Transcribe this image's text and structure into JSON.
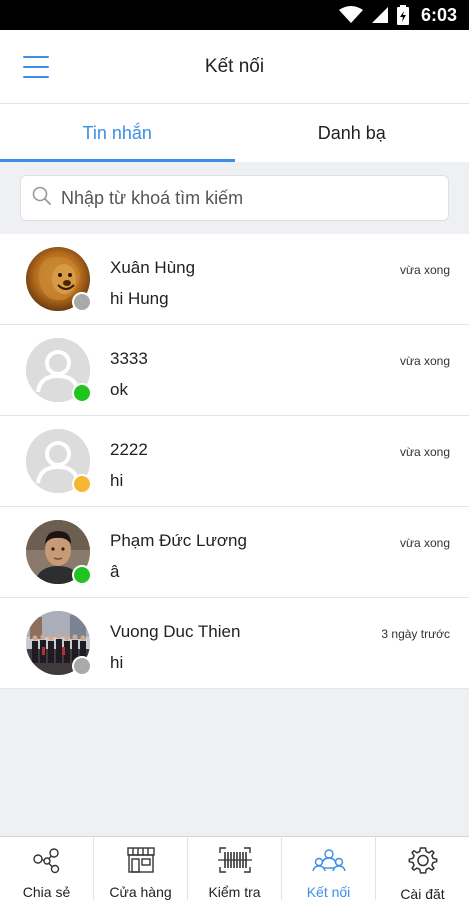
{
  "status_bar": {
    "time": "6:03"
  },
  "header": {
    "title": "Kết nối"
  },
  "tabs": [
    {
      "label": "Tin nhắn",
      "active": true
    },
    {
      "label": "Danh bạ",
      "active": false
    }
  ],
  "search": {
    "placeholder": "Nhập từ khoá tìm kiếm"
  },
  "conversations": [
    {
      "name": "Xuân Hùng",
      "message": "hi Hung",
      "time": "vừa xong",
      "status_color": "#a9a9a9"
    },
    {
      "name": "3333",
      "message": "ok",
      "time": "vừa xong",
      "status_color": "#1fc41f"
    },
    {
      "name": "2222",
      "message": "hi",
      "time": "vừa xong",
      "status_color": "#f5b731"
    },
    {
      "name": "Phạm Đức Lương",
      "message": "â",
      "time": "vừa xong",
      "status_color": "#1fc41f"
    },
    {
      "name": "Vuong Duc Thien",
      "message": "hi",
      "time": "3 ngày trước",
      "status_color": "#a9a9a9"
    }
  ],
  "bottom_nav": [
    {
      "label": "Chia sẻ",
      "icon": "share-icon"
    },
    {
      "label": "Cửa hàng",
      "icon": "store-icon"
    },
    {
      "label": "Kiểm tra",
      "icon": "barcode-icon"
    },
    {
      "label": "Kết nối",
      "icon": "connect-icon",
      "active": true
    },
    {
      "label": "Cài đặt",
      "icon": "gear-icon"
    }
  ],
  "colors": {
    "accent": "#3c8ee6"
  }
}
